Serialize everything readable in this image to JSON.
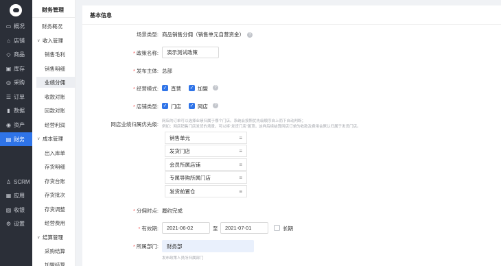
{
  "nav": {
    "items": [
      {
        "label": "概况",
        "icon": "monitor-icon"
      },
      {
        "label": "店铺",
        "icon": "store-icon"
      },
      {
        "label": "商品",
        "icon": "tag-icon"
      },
      {
        "label": "库存",
        "icon": "warehouse-icon"
      },
      {
        "label": "采购",
        "icon": "cart-icon"
      },
      {
        "label": "订单",
        "icon": "list-icon"
      },
      {
        "label": "数据",
        "icon": "bar-chart-icon"
      },
      {
        "label": "资产",
        "icon": "asset-icon"
      },
      {
        "label": "财务",
        "icon": "wallet-icon"
      },
      {
        "label": "SCRM",
        "icon": "user-icon"
      },
      {
        "label": "应用",
        "icon": "grid-icon"
      },
      {
        "label": "收银",
        "icon": "cashier-icon"
      },
      {
        "label": "设置",
        "icon": "gear-icon"
      }
    ]
  },
  "side": {
    "title": "财务管理",
    "overview": "财务概况",
    "groups": [
      {
        "label": "收入管理",
        "items": [
          "销售毛利",
          "销售明细",
          "业绩分佣",
          "收款对账",
          "回款对账",
          "经营利润"
        ]
      },
      {
        "label": "成本管理",
        "items": [
          "出入库单",
          "存货明细",
          "存货台账",
          "存货批次",
          "存货调整",
          "经营费用"
        ]
      },
      {
        "label": "结算管理",
        "items": [
          "采购结算",
          "加盟结算"
        ]
      }
    ]
  },
  "form": {
    "section_title": "基本信息",
    "scene_label": "场景类型:",
    "scene_value": "商品销售分佣（销售单元自营资金）",
    "policy_label": "政策名称:",
    "policy_value": "演示测试政策",
    "publisher_label": "发布主体:",
    "publisher_value": "总部",
    "mode_label": "经营模式:",
    "mode_options": [
      "直营",
      "加盟"
    ],
    "store_type_label": "店铺类型:",
    "store_type_options": [
      "门店",
      "网店"
    ],
    "priority_label": "网店业绩归属优先级:",
    "priority_hint_1": "网店的订单可以选择业绩归属于哪个门店。系统会按照优先级顺序自上而下自动判断；",
    "priority_hint_2": "例如：网店销售门店发货的场景，可以将“发货门店”置顶，这样后续结算网店订单的收款及费用会默认归属于发货门店。",
    "priority_items": [
      "销售单元",
      "发货门店",
      "会员所属店铺",
      "专属导购所属门店",
      "发货前置仓"
    ],
    "commission_time_label": "分佣时点:",
    "commission_time_value": "履约完成",
    "validity_label": "有效期:",
    "start_date": "2021-06-02",
    "to_label": "至",
    "end_date": "2021-07-01",
    "long_term_label": "长期",
    "dept_label": "所属部门:",
    "dept_value": "财务部",
    "dept_hint": "发布政策人员所归属部门"
  }
}
